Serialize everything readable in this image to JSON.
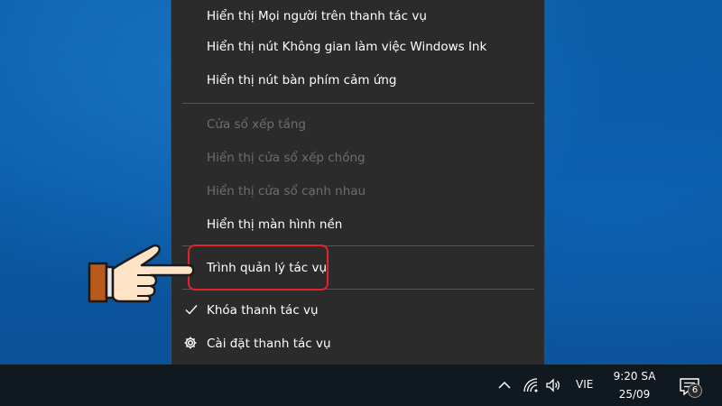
{
  "context_menu": {
    "items": [
      {
        "label": "Hiển thị Mọi người trên thanh tác vụ",
        "enabled": true
      },
      {
        "label": "Hiển thị nút Không gian làm việc Windows Ink",
        "enabled": true
      },
      {
        "label": "Hiển thị nút bàn phím cảm ứng",
        "enabled": true
      },
      {
        "label": "Cửa sổ xếp tầng",
        "enabled": false
      },
      {
        "label": "Hiển thị cửa sổ xếp chồng",
        "enabled": false
      },
      {
        "label": "Hiển thị cửa sổ cạnh nhau",
        "enabled": false
      },
      {
        "label": "Hiển thị màn hình nền",
        "enabled": true
      },
      {
        "label": "Trình quản lý tác vụ",
        "enabled": true,
        "highlighted": true
      },
      {
        "label": "Khóa thanh tác vụ",
        "enabled": true,
        "checked": true,
        "icon": "check-icon"
      },
      {
        "label": "Cài đặt thanh tác vụ",
        "enabled": true,
        "icon": "gear-icon"
      }
    ]
  },
  "taskbar": {
    "tray_icons": [
      "chevron-up-icon",
      "wifi-icon",
      "volume-icon"
    ],
    "language": "VIE",
    "time": "9:20 SA",
    "date": "25/09",
    "notification_count": "6"
  },
  "colors": {
    "menu_bg": "#2b2b2b",
    "highlight": "#e2232b",
    "taskbar_bg": "#101820",
    "desktop": "#0a5aa6"
  }
}
